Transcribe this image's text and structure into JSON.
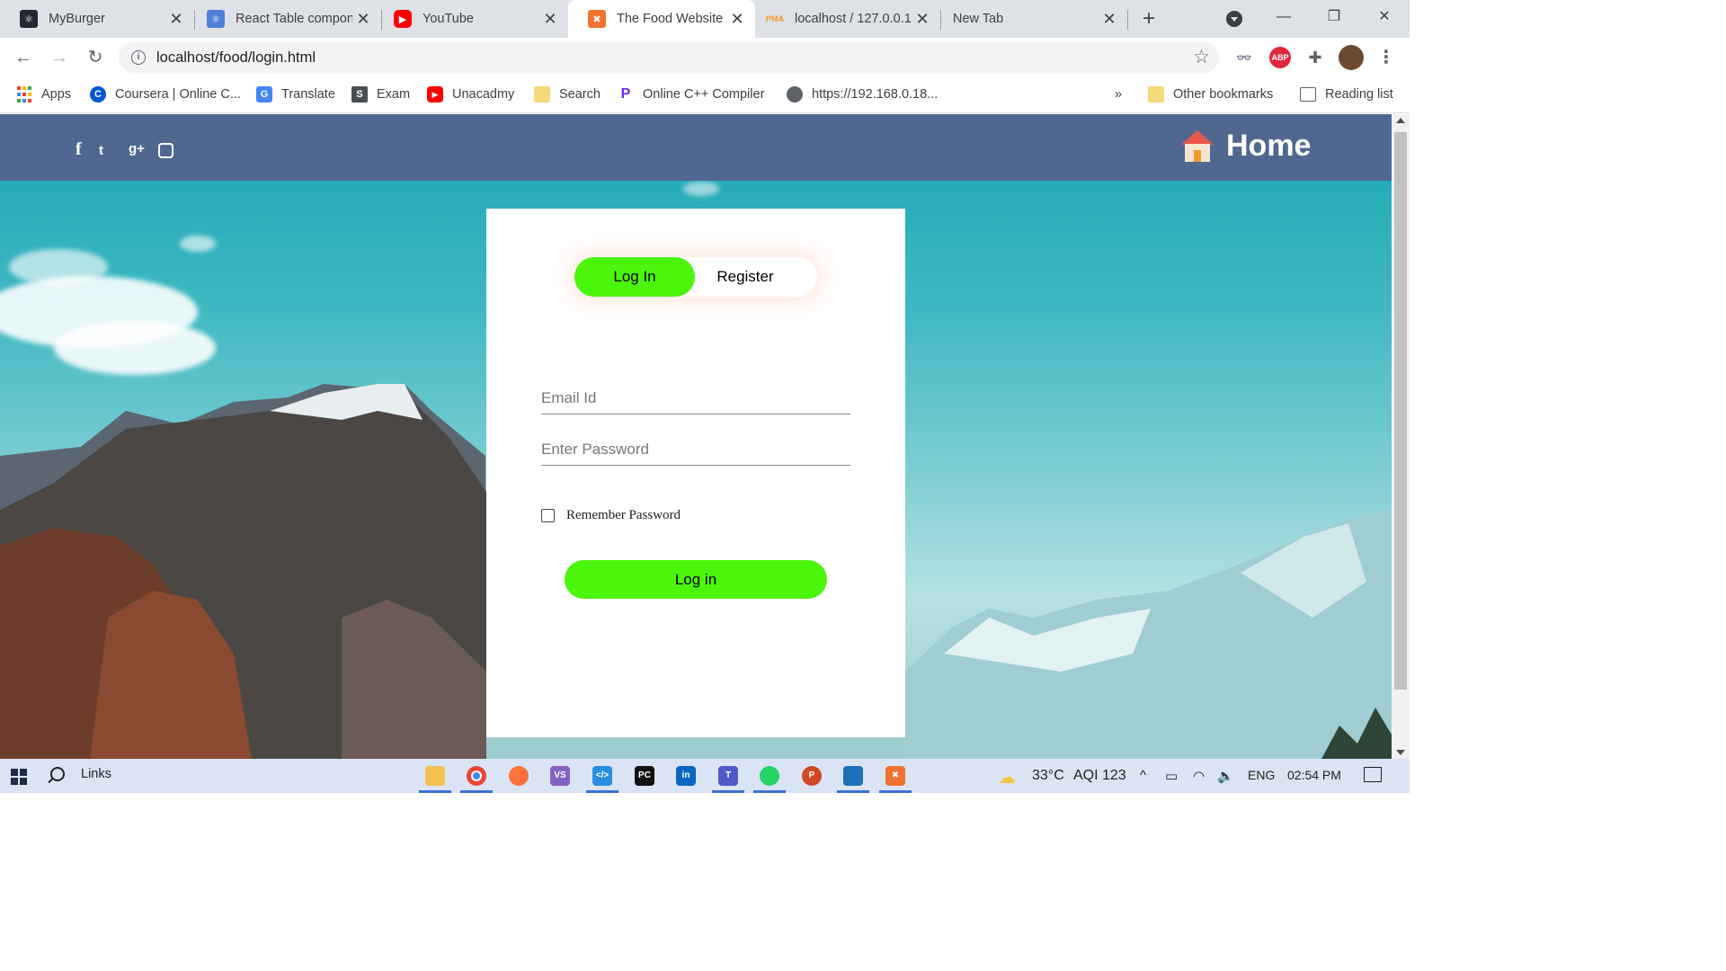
{
  "tabs": [
    {
      "title": "MyBurger",
      "favicon": "react-icon",
      "color": "#222733"
    },
    {
      "title": "React Table compon",
      "favicon": "react-table-icon",
      "color": "#4f7fd8"
    },
    {
      "title": "YouTube",
      "favicon": "youtube-icon",
      "color": "#ff0000"
    },
    {
      "title": "The Food Website",
      "favicon": "xampp-icon",
      "color": "#f27330"
    },
    {
      "title": "localhost / 127.0.0.1",
      "favicon": "phpmyadmin-icon",
      "color": "#f29b24"
    },
    {
      "title": "New Tab",
      "favicon": "",
      "color": ""
    }
  ],
  "address": {
    "url": "localhost/food/login.html"
  },
  "bookmarks": [
    {
      "label": "Apps"
    },
    {
      "label": "Coursera | Online C..."
    },
    {
      "label": "Translate"
    },
    {
      "label": "Exam"
    },
    {
      "label": "Unacadmy"
    },
    {
      "label": "Search"
    },
    {
      "label": "Online C++ Compiler"
    },
    {
      "label": "https://192.168.0.18..."
    }
  ],
  "bookmarks_overflow": "»",
  "other_bookmarks": "Other bookmarks",
  "reading_list": "Reading list",
  "extensions": {
    "abp": "ABP"
  },
  "site": {
    "social": [
      "f",
      "t",
      "g+",
      "ig"
    ],
    "home_label": "Home"
  },
  "login": {
    "toggle_login": "Log In",
    "toggle_register": "Register",
    "email_placeholder": "Email Id",
    "password_placeholder": "Enter Password",
    "remember_label": "Remember Password",
    "submit_label": "Log in",
    "accent": "#4cf50c"
  },
  "taskbar": {
    "search_label": "Links",
    "weather": "33°C",
    "aqi": "AQI 123",
    "lang": "ENG",
    "time": "02:54 PM"
  }
}
